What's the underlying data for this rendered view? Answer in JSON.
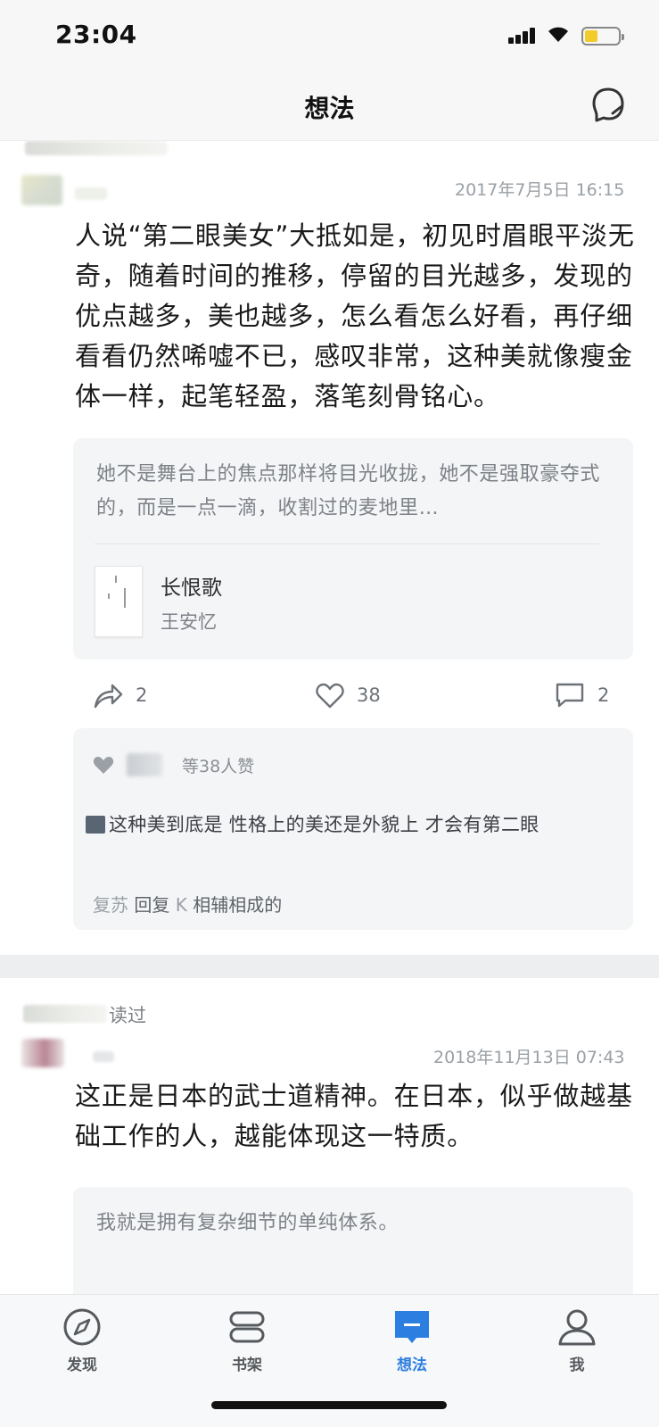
{
  "status_bar": {
    "time": "23:04"
  },
  "nav": {
    "title": "想法"
  },
  "posts": [
    {
      "time": "2017年7月5日 16:15",
      "text": "人说“第二眼美女”大抵如是，初见时眉眼平淡无奇，随着时间的推移，停留的目光越多，发现的优点越多，美也越多，怎么看怎么好看，再仔细看看仍然唏嘘不已，感叹非常，这种美就像瘦金体一样，起笔轻盈，落笔刻骨铭心。",
      "quote": "她不是舞台上的焦点那样将目光收拢，她不是强取豪夺式的，而是一点一滴，收割过的麦地里…",
      "book": {
        "title": "长恨歌",
        "author": "王安忆"
      },
      "shares": "2",
      "likes": "38",
      "comments": "2",
      "likes_summary": "等38人赞",
      "comment_text": "这种美到底是 性格上的美还是外貌上 才会有第二眼",
      "reply": {
        "user": "复苏",
        "verb": "回复",
        "target": "K",
        "text": "相辅相成的"
      }
    },
    {
      "header_suffix": "读过",
      "time": "2018年11月13日 07:43",
      "text": "这正是日本的武士道精神。在日本，似乎做越基础工作的人，越能体现这一特质。",
      "quote": "我就是拥有复杂细节的单纯体系。"
    }
  ],
  "tabs": [
    {
      "label": "发现",
      "icon": "compass-icon"
    },
    {
      "label": "书架",
      "icon": "bookshelf-icon"
    },
    {
      "label": "想法",
      "icon": "thought-bubble-icon",
      "active": true
    },
    {
      "label": "我",
      "icon": "person-icon"
    }
  ],
  "colors": {
    "accent": "#2c7ee0",
    "card_bg": "#f4f5f7",
    "battery": "#f3cb2b"
  }
}
